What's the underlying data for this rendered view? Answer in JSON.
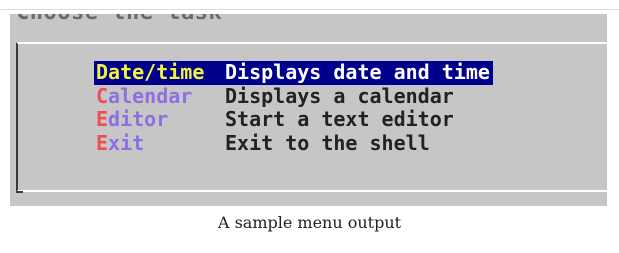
{
  "window": {
    "partial_title": "Choose the task"
  },
  "menu": {
    "items": [
      {
        "hotkey": "D",
        "rest": "ate/time",
        "description": "Displays date and time",
        "selected": true
      },
      {
        "hotkey": "C",
        "rest": "alendar",
        "description": "Displays a calendar",
        "selected": false
      },
      {
        "hotkey": "E",
        "rest": "ditor",
        "description": "Start a text editor",
        "selected": false
      },
      {
        "hotkey": "E",
        "rest": "xit",
        "description": "Exit to the shell",
        "selected": false
      }
    ]
  },
  "colors": {
    "dialog_background": "#c6c6c6",
    "selection_background": "#00008c",
    "selected_tag_text": "#f2f240",
    "selected_description_text": "#ffffff",
    "hotkey_letter": "#ef4d55",
    "tag_text": "#8e6fe1",
    "description_text": "#222222"
  },
  "caption": "A sample menu output"
}
